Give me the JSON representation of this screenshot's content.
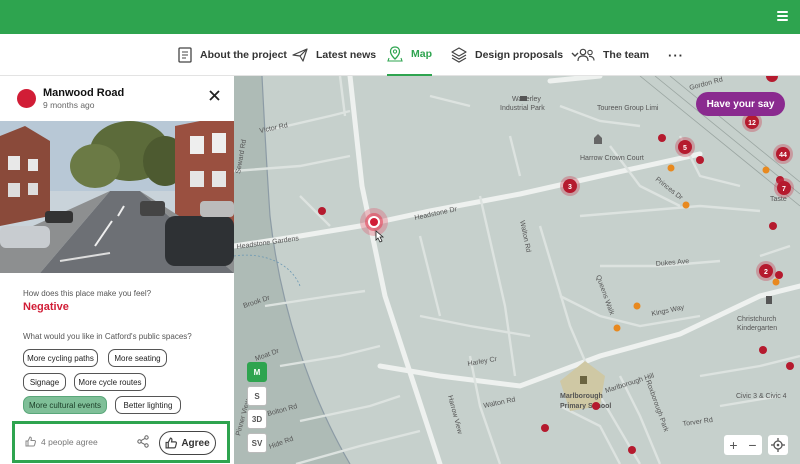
{
  "nav": {
    "items": [
      {
        "label": "About the project",
        "icon": "document-icon"
      },
      {
        "label": "Latest news",
        "icon": "paper-plane-icon"
      },
      {
        "label": "Map",
        "icon": "map-pin-icon",
        "active": true
      },
      {
        "label": "Design proposals",
        "icon": "layers-icon",
        "has_dropdown": true
      },
      {
        "label": "The team",
        "icon": "people-icon"
      }
    ],
    "more": "···"
  },
  "cta": {
    "label": "Have your say"
  },
  "panel": {
    "title": "Manwood Road",
    "time": "9 months ago",
    "q1": "How does this place make you feel?",
    "a1": "Negative",
    "q2": "What would you like in Catford's public spaces?",
    "chips": [
      {
        "label": "More cycling paths",
        "selected": false
      },
      {
        "label": "More seating",
        "selected": false
      },
      {
        "label": "Signage",
        "selected": false
      },
      {
        "label": "More cycle routes",
        "selected": false
      },
      {
        "label": "More cultural events",
        "selected": true
      },
      {
        "label": "Better lighting",
        "selected": false
      }
    ],
    "agree_count": "4 people agree",
    "agree_label": "Agree"
  },
  "map_modes": [
    "M",
    "S",
    "3D",
    "SV"
  ],
  "zoom": {
    "in": "+",
    "out": "−"
  },
  "map_labels": {
    "victor": "Victor Rd",
    "seward": "Seward Rd",
    "waverley": "Waverley",
    "waverley2": "Industrial Park",
    "tooreen": "Toureen Group Limi",
    "gordon": "Gordon Rd",
    "crown": "Harrow Crown Court",
    "princes": "Princes Dr",
    "headstone_dr": "Headstone Dr",
    "headstone_gardens": "Headstone Gardens",
    "walton": "Walton Rd",
    "dukes": "Dukes Ave",
    "queens": "Queens Walk",
    "kings": "Kings Way",
    "brook": "Brook Dr",
    "moat": "Moat Dr",
    "harley": "Harley Cr",
    "marlborough_hill": "Marlborough Hill",
    "marlborough_school": "Marlborough",
    "marlborough_school2": "Primary School",
    "christchurch": "Christchurch",
    "christchurch2": "Kindergarten",
    "bolton": "Bolton Rd",
    "pinner": "Pinner View",
    "hide": "Hide Rd",
    "harrow_view": "Harrow View",
    "walton_bottom": "Walton Rd",
    "roxborough": "Roxborough Park",
    "torver": "Torver Rd",
    "civic": "Civic 3 & Civic 4",
    "taste": "Taste"
  },
  "clusters": [
    "3",
    "5",
    "12",
    "44",
    "7",
    "2",
    "3",
    "7"
  ],
  "colors": {
    "brand": "#2ea44f",
    "cta": "#8a2a8f",
    "pin": "#d11d36",
    "orange": "#e8891f"
  }
}
